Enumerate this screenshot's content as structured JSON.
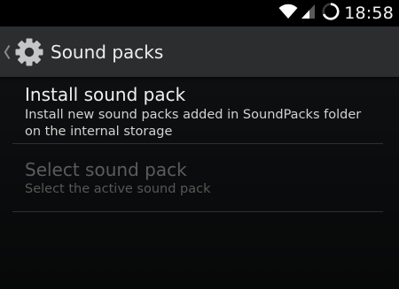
{
  "status_bar": {
    "time": "18:58",
    "icons": [
      "wifi-icon",
      "signal-icon",
      "sync-icon"
    ]
  },
  "action_bar": {
    "title": "Sound packs",
    "icons": [
      "chevron-left-icon",
      "gear-icon"
    ]
  },
  "preferences": [
    {
      "title": "Install sound pack",
      "summary": "Install new sound packs added in SoundPacks folder on the internal storage",
      "enabled": true
    },
    {
      "title": "Select sound pack",
      "summary": "Select the active sound pack",
      "enabled": false
    }
  ],
  "colors": {
    "status_bar_bg": "#000000",
    "action_bar_bg": "#2b2d2f",
    "background": "#0b0c0d",
    "text_primary": "#f0f0f0",
    "text_disabled": "#5c5c5c"
  }
}
